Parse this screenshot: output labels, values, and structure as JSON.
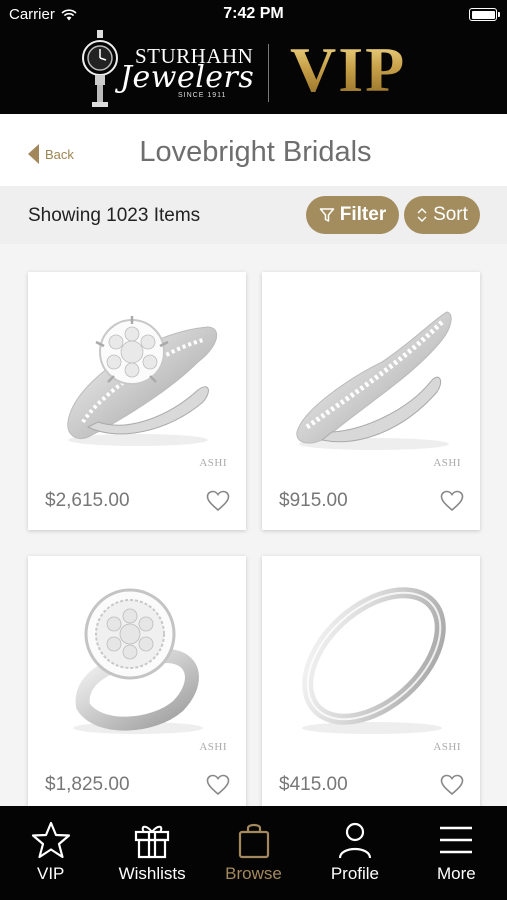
{
  "status_bar": {
    "carrier": "Carrier",
    "time": "7:42 PM"
  },
  "brand": {
    "name_top": "STURHAHN",
    "name_script": "Jewelers",
    "since": "SINCE 1911",
    "vip": "VIP"
  },
  "nav": {
    "back_label": "Back",
    "title": "Lovebright Bridals"
  },
  "results": {
    "count_text": "Showing 1023 Items",
    "filter_label": "Filter",
    "sort_label": "Sort"
  },
  "products": [
    {
      "price": "$2,615.00",
      "maker": "ASHI",
      "image": "cluster-solitaire-ring"
    },
    {
      "price": "$915.00",
      "maker": "ASHI",
      "image": "curved-diamond-band"
    },
    {
      "price": "$1,825.00",
      "maker": "ASHI",
      "image": "halo-cluster-ring"
    },
    {
      "price": "$415.00",
      "maker": "ASHI",
      "image": "plain-white-gold-band"
    }
  ],
  "tabs": [
    {
      "label": "VIP",
      "icon": "star-icon",
      "active": false
    },
    {
      "label": "Wishlists",
      "icon": "gift-icon",
      "active": false
    },
    {
      "label": "Browse",
      "icon": "shopping-bag-icon",
      "active": true
    },
    {
      "label": "Profile",
      "icon": "person-icon",
      "active": false
    },
    {
      "label": "More",
      "icon": "menu-icon",
      "active": false
    }
  ],
  "colors": {
    "accent": "#a38d5e",
    "header_bg": "#050505",
    "tab_active": "#a3895d"
  }
}
